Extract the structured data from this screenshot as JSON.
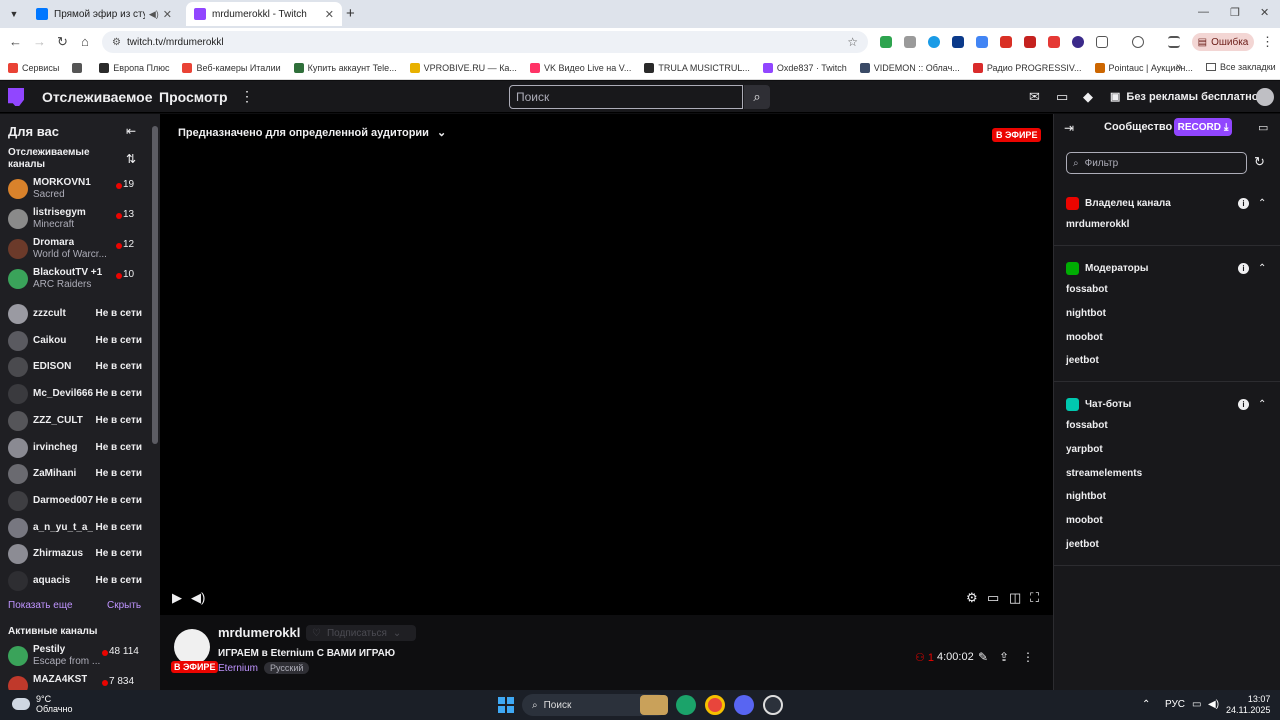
{
  "browser": {
    "tabs": [
      {
        "title": "Прямой эфир из студии «I",
        "active": false
      },
      {
        "title": "mrdumerokkl - Twitch",
        "active": true
      }
    ],
    "url": "twitch.tv/mrdumerokkl",
    "error_label": "Ошибка",
    "bookmarks": [
      {
        "label": "Сервисы",
        "color": "#e94235"
      },
      {
        "label": "",
        "color": "#555555"
      },
      {
        "label": "Европа Плюс",
        "color": "#2a2a2a"
      },
      {
        "label": "Веб-камеры Италии",
        "color": "#e94235"
      },
      {
        "label": "Купить аккаунт Tele...",
        "color": "#2f6f3a"
      },
      {
        "label": "VPROBIVE.RU — Ка...",
        "color": "#e8b100"
      },
      {
        "label": "VK Видео Live на V...",
        "color": "#ff3366"
      },
      {
        "label": "TRULA MUSICTRUL...",
        "color": "#2a2a2a"
      },
      {
        "label": "Oxde837 · Twitch",
        "color": "#9146ff"
      },
      {
        "label": "VIDEMON :: Облач...",
        "color": "#3a4a66"
      },
      {
        "label": "Радио PROGRESSIV...",
        "color": "#d92b2b"
      },
      {
        "label": "Pointauc | Аукцион...",
        "color": "#cc6600"
      }
    ],
    "bookmarks_all": "Все закладки"
  },
  "twitch": {
    "nav": {
      "following": "Отслеживаемое",
      "browse": "Просмотр",
      "search_placeholder": "Поиск",
      "no_ads": "Без рекламы бесплатно"
    },
    "sidebar": {
      "header": "Для вас",
      "followed_title": "Отслеживаемые каналы",
      "live_channels": [
        {
          "name": "MORKOVN1",
          "game": "Sacred",
          "viewers": "19",
          "color": "#d9822b"
        },
        {
          "name": "listrisegym",
          "game": "Minecraft",
          "viewers": "13",
          "color": "#8a8a8a"
        },
        {
          "name": "Dromara",
          "game": "World of Warcr...",
          "viewers": "12",
          "color": "#6b3a2a"
        },
        {
          "name": "BlackoutTV +1",
          "game": "ARC Raiders",
          "viewers": "10",
          "color": "#3aa35a"
        }
      ],
      "offline_channels": [
        {
          "name": "zzzcult",
          "color": "#9a9aa2"
        },
        {
          "name": "Caikou",
          "color": "#5a5a60"
        },
        {
          "name": "EDISON",
          "color": "#4a4a4e"
        },
        {
          "name": "Mc_Devil666",
          "color": "#3a3a3e"
        },
        {
          "name": "ZZZ_CULT",
          "color": "#555559"
        },
        {
          "name": "irvincheg",
          "color": "#8a8a92"
        },
        {
          "name": "ZaMihani",
          "color": "#6a6a70"
        },
        {
          "name": "Darmoed007",
          "color": "#3e3e42"
        },
        {
          "name": "a_n_yu_t_a_",
          "color": "#777780"
        },
        {
          "name": "Zhirmazus",
          "color": "#8c8c94"
        },
        {
          "name": "aquacis",
          "color": "#2e2e32"
        }
      ],
      "offline_label": "Не в сети",
      "show_more": "Показать еще",
      "hide": "Скрыть",
      "active_title": "Активные каналы",
      "active_channels": [
        {
          "name": "Pestily",
          "game": "Escape from ...",
          "viewers": "48 114",
          "color": "#3aa35a"
        },
        {
          "name": "MAZA4KST",
          "game": "",
          "viewers": "7 834",
          "color": "#c0392b"
        }
      ]
    },
    "player": {
      "audience_notice": "Предназначено для определенной аудитории",
      "live_badge": "В ЭФИРЕ"
    },
    "stream": {
      "channel": "mrdumerokkl",
      "follow_state": "Подписаться",
      "title": "ИГРАЕМ в Eternium С ВАМИ ИГРАЮ",
      "game": "Eternium",
      "tag": "Русский",
      "viewers": "1",
      "uptime": "4:00:02",
      "live_badge": "В ЭФИРЕ"
    },
    "community": {
      "title": "Сообщество",
      "record": "RECORD",
      "filter_placeholder": "Фильтр",
      "groups": [
        {
          "title": "Владелец канала",
          "badge_color": "#eb0400",
          "members": [
            "mrdumerokkl"
          ]
        },
        {
          "title": "Модераторы",
          "badge_color": "#00ad03",
          "members": [
            "fossabot",
            "nightbot",
            "moobot",
            "jeetbot"
          ]
        },
        {
          "title": "Чат-боты",
          "badge_color": "#00c8af",
          "members": [
            "fossabot",
            "yarpbot",
            "streamelements",
            "nightbot",
            "moobot",
            "jeetbot"
          ]
        }
      ]
    }
  },
  "taskbar": {
    "weather_temp": "9°C",
    "weather_desc": "Облачно",
    "search": "Поиск",
    "lang": "РУС",
    "time": "13:07",
    "date": "24.11.2025"
  }
}
